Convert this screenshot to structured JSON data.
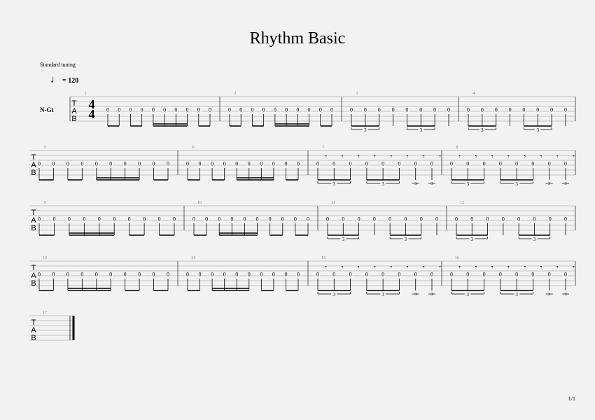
{
  "header": {
    "title": "Rhythm Basic",
    "tuning": "Standard tuning",
    "tempo_symbol": "♩",
    "tempo_value": "= 120",
    "instrument": "N-Gt",
    "page_number": "1/1"
  },
  "tab_clef": [
    "T",
    "A",
    "B"
  ],
  "time_signature": {
    "numerator": "4",
    "denominator": "4"
  },
  "tuplet_label": "3",
  "fret": "0",
  "rest_glyph": "𝄾",
  "patterns": {
    "A": [
      [
        2,
        "eighth"
      ],
      [
        2,
        "eighth"
      ],
      [
        4,
        "sixteenth"
      ],
      [
        2,
        "eighth"
      ]
    ],
    "B": [
      [
        3,
        "triplet"
      ],
      [
        1,
        "quarter"
      ],
      [
        3,
        "triplet"
      ],
      [
        1,
        "quarter"
      ]
    ],
    "C": [
      [
        3,
        "triplet-rest"
      ],
      [
        3,
        "triplet-rest"
      ],
      [
        1,
        "quarter-rest"
      ],
      [
        1,
        "quarter-rest"
      ]
    ],
    "D": [
      [
        2,
        "eighth"
      ],
      [
        4,
        "sixteenth"
      ],
      [
        2,
        "eighth"
      ],
      [
        2,
        "eighth"
      ]
    ]
  },
  "systems": [
    {
      "measures": [
        {
          "number": "1",
          "pattern": "A"
        },
        {
          "number": "2",
          "pattern": "A"
        },
        {
          "number": "3",
          "pattern": "B"
        },
        {
          "number": "4",
          "pattern": "B"
        }
      ]
    },
    {
      "measures": [
        {
          "number": "5",
          "pattern": "A"
        },
        {
          "number": "6",
          "pattern": "A"
        },
        {
          "number": "7",
          "pattern": "C"
        },
        {
          "number": "8",
          "pattern": "C"
        }
      ]
    },
    {
      "measures": [
        {
          "number": "9",
          "pattern": "D"
        },
        {
          "number": "10",
          "pattern": "D"
        },
        {
          "number": "11",
          "pattern": "B"
        },
        {
          "number": "12",
          "pattern": "B"
        }
      ]
    },
    {
      "measures": [
        {
          "number": "13",
          "pattern": "D"
        },
        {
          "number": "14",
          "pattern": "D"
        },
        {
          "number": "15",
          "pattern": "C"
        },
        {
          "number": "16",
          "pattern": "C"
        }
      ]
    },
    {
      "measures": [
        {
          "number": "17",
          "pattern": "end"
        }
      ]
    }
  ],
  "colors": {
    "background": "#f2f2f2",
    "staff_line": "#b5b5b5",
    "ink": "#000000"
  }
}
